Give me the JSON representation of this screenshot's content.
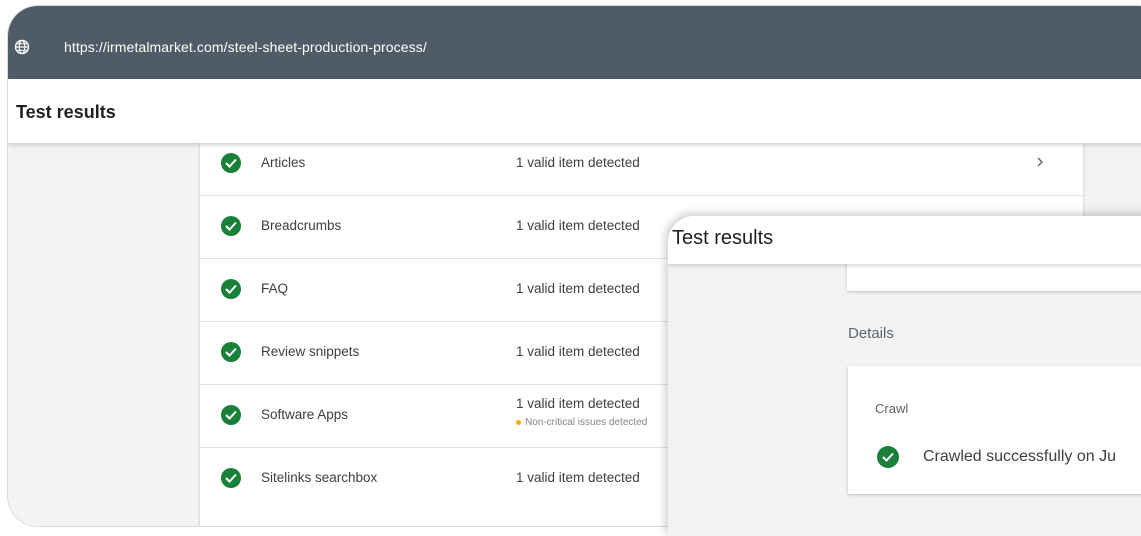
{
  "browser": {
    "url": "https://irmetalmarket.com/steel-sheet-production-process/",
    "globe_icon": "globe-icon"
  },
  "page": {
    "title": "Test results"
  },
  "results": [
    {
      "name": "Articles",
      "status": "1 valid item detected",
      "note": ""
    },
    {
      "name": "Breadcrumbs",
      "status": "1 valid item detected",
      "note": ""
    },
    {
      "name": "FAQ",
      "status": "1 valid item detected",
      "note": ""
    },
    {
      "name": "Review snippets",
      "status": "1 valid item detected",
      "note": ""
    },
    {
      "name": "Software Apps",
      "status": "1 valid item detected",
      "note": "Non-critical issues detected"
    },
    {
      "name": "Sitelinks searchbox",
      "status": "1 valid item detected",
      "note": ""
    }
  ],
  "overlay": {
    "title": "Test results",
    "details_label": "Details",
    "crawl_title": "Crawl",
    "crawl_status": "Crawled successfully on Ju"
  },
  "colors": {
    "header_bar": "#4f5b66",
    "success": "#188038",
    "warning": "#f9ab00"
  }
}
